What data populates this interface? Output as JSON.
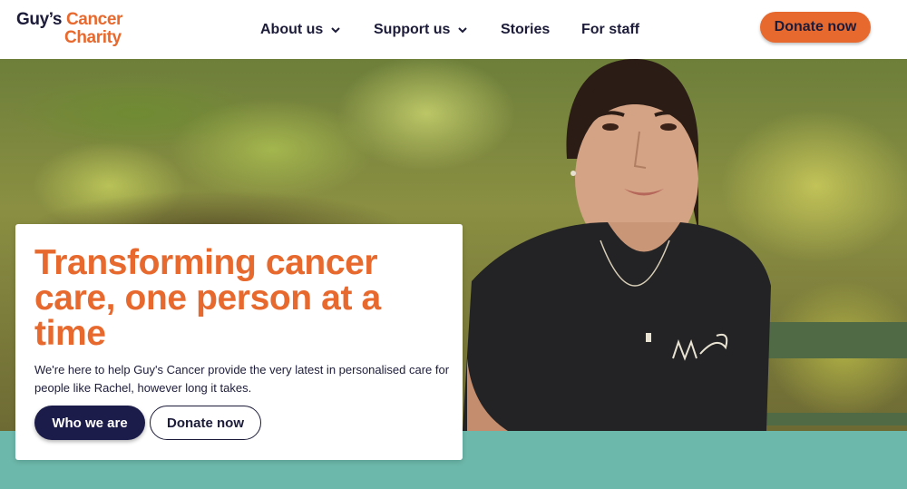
{
  "logo": {
    "line1_a": "Guy’s",
    "line1_b": "Cancer",
    "line2": "Charity"
  },
  "nav": [
    {
      "label": "About us",
      "has_dropdown": true
    },
    {
      "label": "Support us",
      "has_dropdown": true
    },
    {
      "label": "Stories",
      "has_dropdown": false
    },
    {
      "label": "For staff",
      "has_dropdown": false
    }
  ],
  "header": {
    "donate_label": "Donate now"
  },
  "hero": {
    "headline": "Transforming cancer care, one person at a time",
    "lead": "We're here to help Guy's Cancer provide the very latest in personalised care for people like Rachel, however long it takes.",
    "primary_button": "Who we are",
    "secondary_button": "Donate now"
  },
  "colors": {
    "brand_orange": "#e8692e",
    "navy": "#1c1c3a",
    "teal_band": "#6cb8aa"
  },
  "icons": {
    "nav_dropdown": "chevron-down-icon"
  }
}
